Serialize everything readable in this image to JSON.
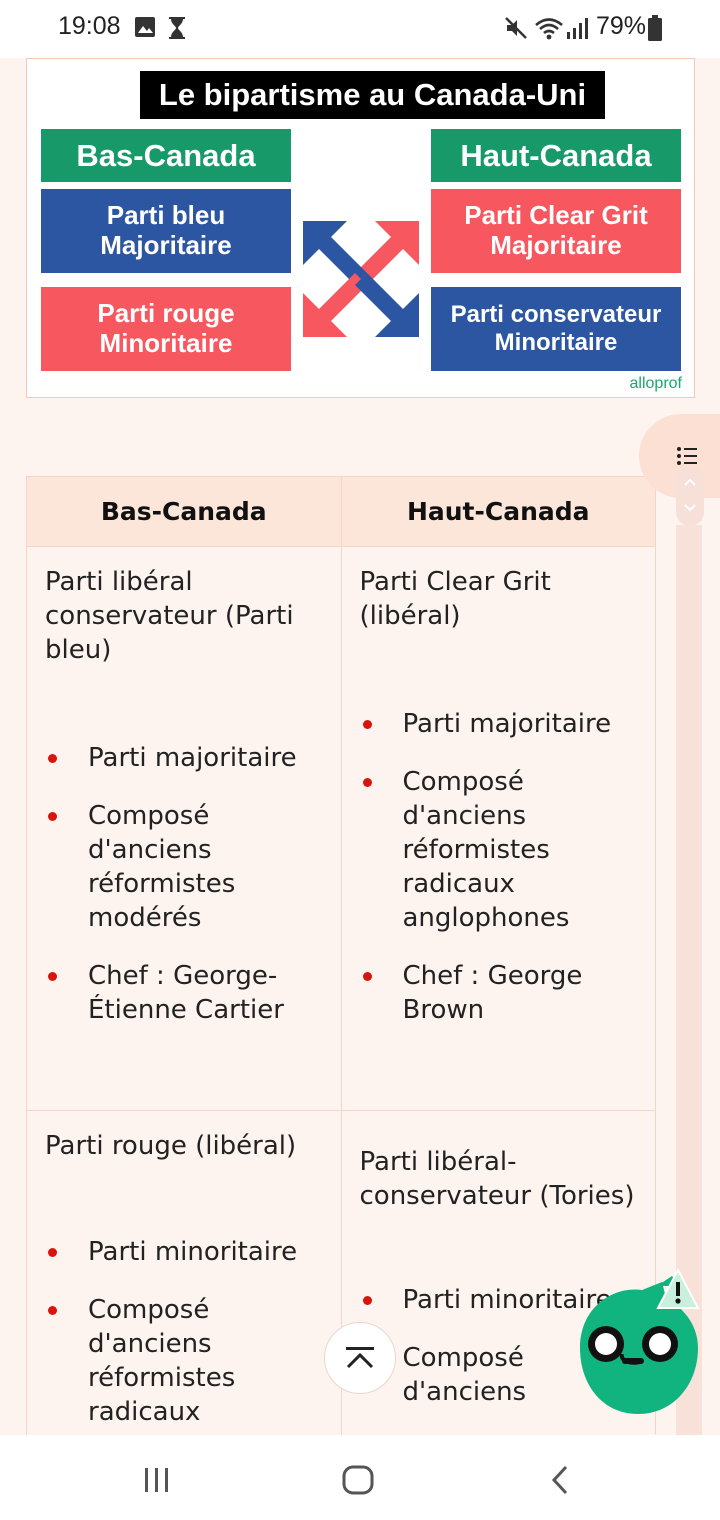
{
  "status_bar": {
    "time": "19:08",
    "battery": "79%"
  },
  "infographic": {
    "title": "Le bipartisme au Canada-Uni",
    "left_region": "Bas-Canada",
    "right_region": "Haut-Canada",
    "left_top": [
      "Parti bleu",
      "Majoritaire"
    ],
    "left_bottom": [
      "Parti rouge",
      "Minoritaire"
    ],
    "right_top": [
      "Parti Clear Grit",
      "Majoritaire"
    ],
    "right_bottom": [
      "Parti conservateur",
      "Minoritaire"
    ],
    "brand": "alloprof",
    "colors": {
      "green": "#18996a",
      "blue": "#2c56a1",
      "red": "#f7575e"
    }
  },
  "table": {
    "headers": [
      "Bas-Canada",
      "Haut-Canada"
    ],
    "rows": [
      [
        {
          "title": "Parti libéral conservateur (Parti bleu)",
          "bullets": [
            "Parti majoritaire",
            "Composé d'anciens réformistes modérés",
            "Chef : George-Étienne Cartier"
          ]
        },
        {
          "title": "Parti Clear Grit (libéral)",
          "bullets": [
            "Parti majoritaire",
            "Composé d'anciens réformistes radicaux anglophones",
            "Chef : George Brown"
          ]
        }
      ],
      [
        {
          "title": "Parti rouge (libéral)",
          "bullets": [
            "Parti minoritaire",
            "Composé d'anciens réformistes radicaux"
          ]
        },
        {
          "title": "Parti libéral-conservateur (Tories)",
          "bullets": [
            "Parti minoritaire",
            "Composé d'anciens"
          ]
        }
      ]
    ]
  },
  "icons": {
    "toc": "table-of-contents-icon",
    "back_to_top": "chevron-up-icon",
    "mascot": "mascot-icon"
  },
  "accent_color": "#d8140d"
}
